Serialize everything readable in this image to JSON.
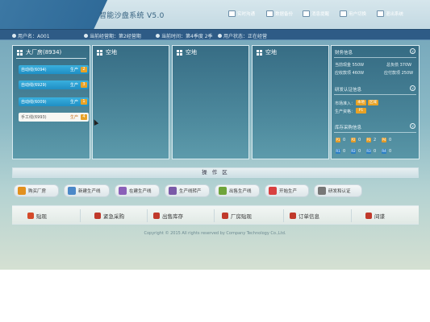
{
  "header": {
    "title": "智能沙盘系统 V5.0",
    "buttons": [
      {
        "label": "实时沟通",
        "icon": "chat-icon"
      },
      {
        "label": "数据备份",
        "icon": "backup-icon"
      },
      {
        "label": "消息提醒",
        "icon": "mail-icon"
      },
      {
        "label": "用户切换",
        "icon": "user-icon"
      },
      {
        "label": "退出系统",
        "icon": "power-icon"
      }
    ]
  },
  "infobar": {
    "user": "用户名：A001",
    "period": "当前经营期：第2经营期",
    "time": "当前时间：第4季度 2季",
    "status": "用户状态：正在经营"
  },
  "panels": {
    "main": {
      "title": "大厂房(8934)",
      "items": [
        {
          "label": "自动线(6094)",
          "tag": "生产",
          "num": "2",
          "style": "blue"
        },
        {
          "label": "自动线(6929)",
          "tag": "生产",
          "num": "3",
          "style": "blue"
        },
        {
          "label": "自动线(6009)",
          "tag": "生产",
          "num": "1",
          "style": "blue"
        },
        {
          "label": "手工线(6993)",
          "tag": "生产",
          "num": "4",
          "style": "white"
        }
      ]
    },
    "empty": [
      {
        "title": "空地"
      },
      {
        "title": "空地"
      },
      {
        "title": "空地"
      }
    ]
  },
  "side": {
    "s1": {
      "title": "财务信息",
      "rows": [
        {
          "left": "当前现金 550W",
          "right": "总负债 370W"
        },
        {
          "left": "应收款项 460W",
          "right": "应付款项 250W"
        }
      ]
    },
    "s2": {
      "title": "研发认证信息",
      "rows": [
        {
          "label": "市场准入：",
          "chips": [
            "本地",
            "区域"
          ]
        },
        {
          "label": "生产资格：",
          "chips": [
            "P1"
          ]
        }
      ]
    },
    "s3": {
      "title": "库存采购信息",
      "row1": [
        {
          "label": "P1",
          "value": "0",
          "color": "o"
        },
        {
          "label": "P2",
          "value": "0",
          "color": "o"
        },
        {
          "label": "P3",
          "value": "2",
          "color": "o"
        },
        {
          "label": "P4",
          "value": "0",
          "color": "o"
        }
      ],
      "row2": [
        {
          "label": "R1",
          "value": "0",
          "color": "b"
        },
        {
          "label": "R2",
          "value": "0",
          "color": "b"
        },
        {
          "label": "R3",
          "value": "0",
          "color": "b"
        },
        {
          "label": "R4",
          "value": "0",
          "color": "b"
        }
      ]
    }
  },
  "opbar": {
    "title": "操 作 区"
  },
  "actions": [
    {
      "label": "购买厂房",
      "icon": "house-icon",
      "color": "#e2901e"
    },
    {
      "label": "新建生产线",
      "icon": "tools-icon",
      "color": "#4c88c8"
    },
    {
      "label": "在建生产线",
      "icon": "build-icon",
      "color": "#8a5fb8"
    },
    {
      "label": "生产线转产",
      "icon": "switch-icon",
      "color": "#7a5aa8"
    },
    {
      "label": "出售生产线",
      "icon": "sell-icon",
      "color": "#6fa43a"
    },
    {
      "label": "开始生产",
      "icon": "start-icon",
      "color": "#d84040"
    },
    {
      "label": "研发和认证",
      "icon": "research-icon",
      "color": "#777777"
    }
  ],
  "bottom": [
    {
      "label": "贴现",
      "icon": "discount-icon",
      "color": "#d44a2a"
    },
    {
      "label": "紧急采购",
      "icon": "purchase-icon",
      "color": "#c0392b"
    },
    {
      "label": "出售库存",
      "icon": "stock-icon",
      "color": "#c0392b"
    },
    {
      "label": "厂房贴现",
      "icon": "plant-icon",
      "color": "#c0392b"
    },
    {
      "label": "订单信息",
      "icon": "order-icon",
      "color": "#c0392b"
    },
    {
      "label": "间谍",
      "icon": "spy-icon",
      "color": "#c0392b"
    }
  ],
  "copyright": "Copyright © 2015 All rights reserved by Company Technology Co.,Ltd."
}
